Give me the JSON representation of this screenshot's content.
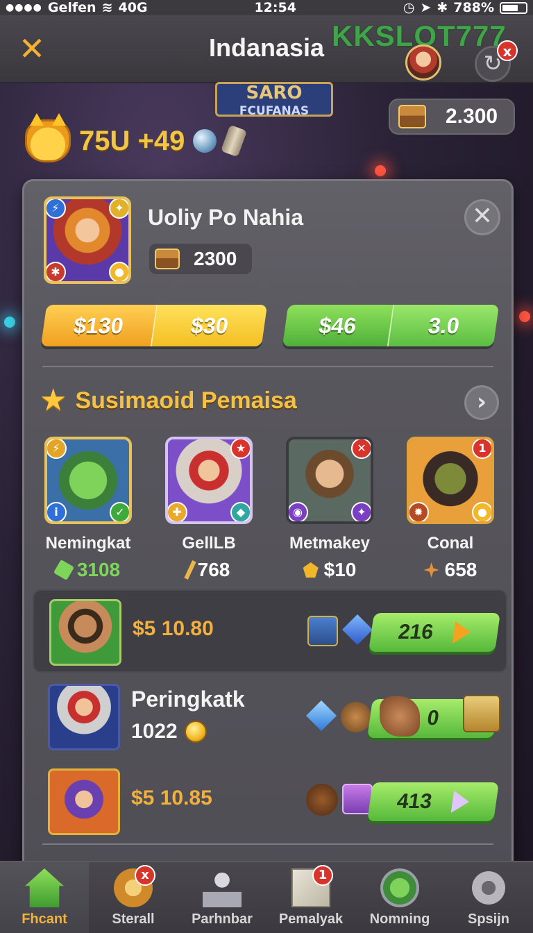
{
  "status_bar": {
    "carrier": "Gelfen",
    "network": "40G",
    "time": "12:54",
    "battery": "788%"
  },
  "header": {
    "title": "Indanasia",
    "watermark": "KKSLOT777",
    "refresh_badge": "x"
  },
  "scene": {
    "banner_title": "SARO",
    "banner_sub": "FCUFANAS"
  },
  "top_currency": {
    "value": "2.300",
    "icon": "treasure-chest-icon"
  },
  "level": {
    "text": "75U +49"
  },
  "featured_hero": {
    "name": "Uoliy Po Nahia",
    "chest_value": "2300",
    "price_gold": [
      "$130",
      "$30"
    ],
    "price_green": [
      "$46",
      "3.0"
    ]
  },
  "section": {
    "title": "Susimaoid Pemaisa"
  },
  "heroes": [
    {
      "name": "Nemingkat",
      "stat": "3108",
      "stat_color": "#7dd65a"
    },
    {
      "name": "GellLB",
      "stat": "768",
      "stat_color": "#ffffff"
    },
    {
      "name": "Metmakey",
      "stat": "$10",
      "stat_color": "#ffffff"
    },
    {
      "name": "Conal",
      "stat": "658",
      "stat_color": "#ffffff"
    }
  ],
  "offers": [
    {
      "price": "$5 10.80",
      "button": "216"
    },
    {
      "title": "Peringkatk",
      "sub": "1022",
      "button": "0"
    },
    {
      "price": "$5 10.85",
      "button": "413"
    }
  ],
  "nav": [
    {
      "label": "Fhcant",
      "icon": "home-icon"
    },
    {
      "label": "Sterall",
      "icon": "gear-icon",
      "badge": "x"
    },
    {
      "label": "Parhnbar",
      "icon": "joystick-icon"
    },
    {
      "label": "Pemalyak",
      "icon": "mail-icon",
      "badge": "1"
    },
    {
      "label": "Nomning",
      "icon": "sword-icon"
    },
    {
      "label": "Spsijn",
      "icon": "settings-gear-icon"
    }
  ]
}
